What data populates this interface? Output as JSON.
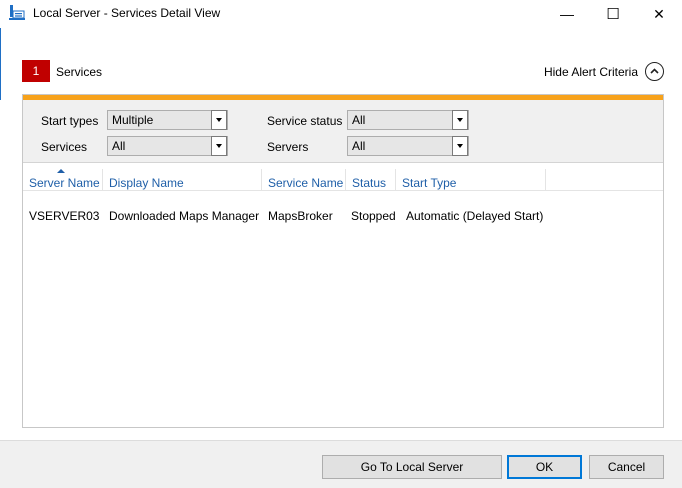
{
  "window": {
    "title": "Local Server - Services Detail View",
    "minimize": "—",
    "maximize": "☐",
    "close": "✕"
  },
  "header": {
    "count": "1",
    "section": "Services",
    "hide_alert_criteria": "Hide Alert Criteria"
  },
  "filters": {
    "start_types_label": "Start types",
    "start_types_value": "Multiple",
    "service_status_label": "Service status",
    "service_status_value": "All",
    "services_label": "Services",
    "services_value": "All",
    "servers_label": "Servers",
    "servers_value": "All"
  },
  "table": {
    "columns": [
      "Server Name",
      "Display Name",
      "Service Name",
      "Status",
      "Start Type"
    ],
    "rows": [
      [
        "VSERVER03",
        "Downloaded Maps Manager",
        "MapsBroker",
        "Stopped",
        "Automatic (Delayed Start)"
      ]
    ]
  },
  "footer": {
    "go_to_label": "Go To Local Server",
    "ok_label": "OK",
    "cancel_label": "Cancel"
  },
  "colors": {
    "accent": "#f7a21b",
    "badge": "#c00000",
    "link": "#1f5fa8"
  }
}
